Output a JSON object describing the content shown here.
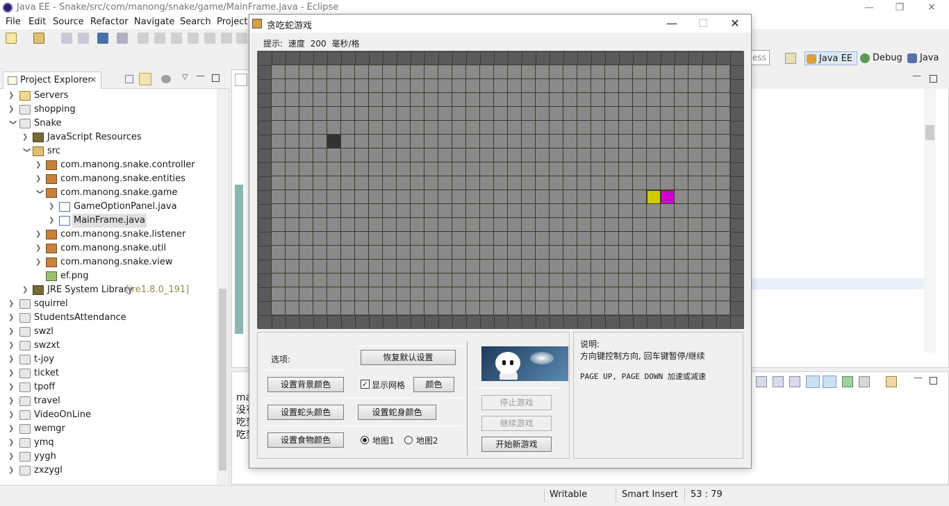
{
  "window": {
    "title": "Java EE - Snake/src/com/manong/snake/game/MainFrame.java - Eclipse"
  },
  "menu": {
    "items": [
      "File",
      "Edit",
      "Source",
      "Refactor",
      "Navigate",
      "Search",
      "Project"
    ]
  },
  "perspectives": {
    "quick_access_partial": "ess",
    "items": [
      "Java EE",
      "Debug",
      "Java"
    ]
  },
  "explorer": {
    "tab_label": "Project Explorer",
    "tree": [
      {
        "label": "Servers",
        "icon": "folder-icon"
      },
      {
        "label": "shopping",
        "icon": "project-icon"
      },
      {
        "label": "Snake",
        "icon": "project-icon"
      },
      {
        "label": "JavaScript Resources",
        "icon": "library-icon"
      },
      {
        "label": "src",
        "icon": "source-folder-icon"
      },
      {
        "label": "com.manong.snake.controller",
        "icon": "package-icon"
      },
      {
        "label": "com.manong.snake.entities",
        "icon": "package-icon"
      },
      {
        "label": "com.manong.snake.game",
        "icon": "package-icon"
      },
      {
        "label": "GameOptionPanel.java",
        "icon": "java-file-icon"
      },
      {
        "label": "MainFrame.java",
        "icon": "java-file-icon"
      },
      {
        "label": "com.manong.snake.listener",
        "icon": "package-icon"
      },
      {
        "label": "com.manong.snake.util",
        "icon": "package-icon"
      },
      {
        "label": "com.manong.snake.view",
        "icon": "package-icon"
      },
      {
        "label": "ef.png",
        "icon": "image-file-icon"
      },
      {
        "label": "JRE System Library",
        "suffix": "[jre1.8.0_191]",
        "icon": "library-icon"
      },
      {
        "label": "squirrel",
        "icon": "project-icon"
      },
      {
        "label": "StudentsAttendance",
        "icon": "project-icon"
      },
      {
        "label": "swzl",
        "icon": "project-icon"
      },
      {
        "label": "swzxt",
        "icon": "project-icon"
      },
      {
        "label": "t-joy",
        "icon": "project-icon"
      },
      {
        "label": "ticket",
        "icon": "project-icon"
      },
      {
        "label": "tpoff",
        "icon": "project-icon"
      },
      {
        "label": "travel",
        "icon": "project-icon"
      },
      {
        "label": "VideoOnLine",
        "icon": "project-icon"
      },
      {
        "label": "wemgr",
        "icon": "project-icon"
      },
      {
        "label": "ymq",
        "icon": "project-icon"
      },
      {
        "label": "yygh",
        "icon": "project-icon"
      },
      {
        "label": "zxzygl",
        "icon": "project-icon"
      }
    ]
  },
  "console": {
    "lines": [
      "mai",
      "没有",
      "吃到",
      "吃到"
    ]
  },
  "status": {
    "writable": "Writable",
    "insert_mode": "Smart Insert",
    "position": "53 : 79"
  },
  "game": {
    "title": "贪吃蛇游戏",
    "hint_label": "提示:",
    "speed_label": "速度",
    "speed_value": "200",
    "speed_unit": "毫秒/格",
    "grid": {
      "cols": 33,
      "rows": 18,
      "border_cells": 1
    },
    "obstacle": {
      "col": 4,
      "row": 5,
      "color": "#333333"
    },
    "snake": {
      "head": {
        "col": 28,
        "row": 9,
        "color": "#cc00cc"
      },
      "body": [
        {
          "col": 27,
          "row": 9,
          "color": "#cccc00"
        }
      ]
    },
    "colors": {
      "background": "#8a8a8a",
      "grid_line": "#3a3a28",
      "border": "#5a5a5a"
    },
    "options": {
      "label": "选项:",
      "restore_defaults": "恢复默认设置",
      "set_background_color": "设置背景颜色",
      "show_grid": "显示网格",
      "show_grid_checked": true,
      "color": "颜色",
      "set_head_color": "设置蛇头颜色",
      "set_body_color": "设置蛇身颜色",
      "set_food_color": "设置食物颜色",
      "map1": "地图1",
      "map2": "地图2",
      "selected_map": "map1"
    },
    "controls": {
      "stop": "停止游戏",
      "resume": "继续游戏",
      "new_game": "开始新游戏"
    },
    "info": {
      "title": "说明:",
      "line1": "方向键控制方向, 回车键暂停/继续",
      "line2": "PAGE UP, PAGE DOWN 加速或减速"
    }
  }
}
